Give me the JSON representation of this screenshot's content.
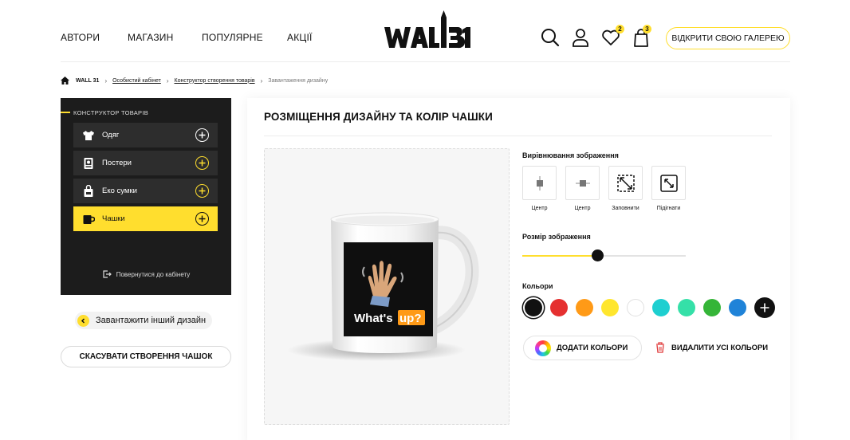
{
  "header": {
    "nav": [
      "Автори",
      "Магазин",
      "Популярне",
      "Акції"
    ],
    "logo_text": "WALL31",
    "favorites_count": "2",
    "cart_count": "3",
    "gallery_button": "Відкрити свою галерею"
  },
  "breadcrumb": {
    "root": "WALL 31",
    "items": [
      "Особистий кабінет",
      "Конструктор створення товарів"
    ],
    "current": "Завантаження дизайну"
  },
  "sidebar": {
    "title": "Конструктор товарів",
    "items": [
      {
        "label": "Одяг",
        "icon": "tshirt-icon"
      },
      {
        "label": "Постери",
        "icon": "poster-icon"
      },
      {
        "label": "Еко сумки",
        "icon": "bag-icon"
      },
      {
        "label": "Чашки",
        "icon": "mug-icon",
        "active": true
      }
    ],
    "back_label": "Повернутися до кабінету",
    "upload_label": "Завантажити інший дизайн",
    "cancel_label": "Скасувати створення чашок"
  },
  "panel": {
    "title": "Розміщення дизайну та колір чашки",
    "mug_text_1": "What's",
    "mug_text_2": "up?",
    "alignment_label": "Вирівнювання зображення",
    "alignment_options": [
      "Центр",
      "Центр",
      "Заповнити",
      "Підігнати"
    ],
    "size_label": "Розмір зображення",
    "size_value": 0.46,
    "colors_label": "Кольори",
    "colors": [
      "#111111",
      "#e53030",
      "#ff9a17",
      "#ffe62e",
      "#ffffff",
      "#1ecfd0",
      "#35e0a8",
      "#35b538",
      "#1f83d8"
    ],
    "selected_color": "#111111",
    "add_colors_label": "Додати кольори",
    "delete_colors_label": "Видалити усі кольори"
  },
  "accent": "#ffde2e"
}
